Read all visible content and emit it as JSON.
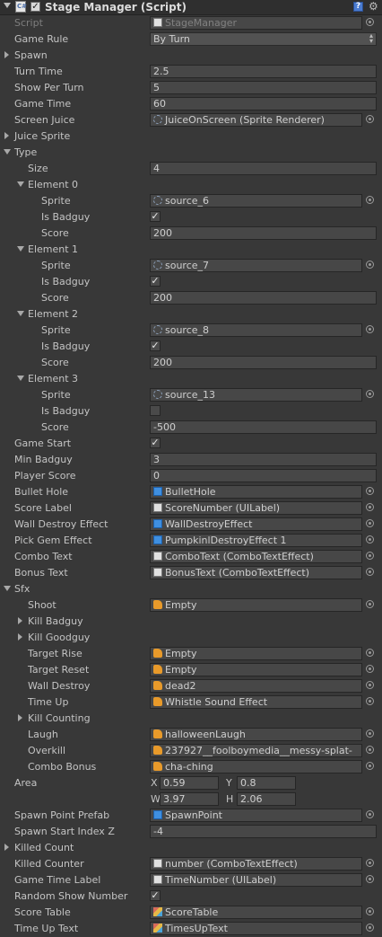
{
  "component": {
    "title": "Stage Manager (Script)",
    "enabled": true,
    "icons": [
      "script-icon",
      "help-icon",
      "gear-icon"
    ]
  },
  "fields": {
    "script": {
      "label": "Script",
      "value": "StageManager"
    },
    "game_rule": {
      "label": "Game Rule",
      "value": "By Turn"
    },
    "spawn": {
      "label": "Spawn"
    },
    "turn_time": {
      "label": "Turn Time",
      "value": "2.5"
    },
    "show_per_turn": {
      "label": "Show Per Turn",
      "value": "5"
    },
    "game_time": {
      "label": "Game Time",
      "value": "60"
    },
    "screen_juice": {
      "label": "Screen Juice",
      "value": "JuiceOnScreen (Sprite Renderer)"
    },
    "juice_sprite": {
      "label": "Juice Sprite"
    },
    "type": {
      "label": "Type"
    },
    "size": {
      "label": "Size",
      "value": "4"
    },
    "sprite_label": "Sprite",
    "is_badguy_label": "Is Badguy",
    "score_label": "Score",
    "elements": [
      {
        "label": "Element 0",
        "sprite": "source_6",
        "is_badguy": true,
        "score": "200"
      },
      {
        "label": "Element 1",
        "sprite": "source_7",
        "is_badguy": true,
        "score": "200"
      },
      {
        "label": "Element 2",
        "sprite": "source_8",
        "is_badguy": true,
        "score": "200"
      },
      {
        "label": "Element 3",
        "sprite": "source_13",
        "is_badguy": false,
        "score": "-500"
      }
    ],
    "game_start": {
      "label": "Game Start",
      "checked": true
    },
    "min_badguy": {
      "label": "Min Badguy",
      "value": "3"
    },
    "player_score": {
      "label": "Player Score",
      "value": "0"
    },
    "bullet_hole": {
      "label": "Bullet Hole",
      "value": "BulletHole"
    },
    "score_label_field": {
      "label": "Score Label",
      "value": "ScoreNumber (UILabel)"
    },
    "wall_destroy_effect": {
      "label": "Wall Destroy Effect",
      "value": "WallDestroyEffect"
    },
    "pick_gem_effect": {
      "label": "Pick Gem Effect",
      "value": "PumpkinlDestroyEffect 1"
    },
    "combo_text": {
      "label": "Combo Text",
      "value": "ComboText (ComboTextEffect)"
    },
    "bonus_text": {
      "label": "Bonus Text",
      "value": "BonusText (ComboTextEffect)"
    },
    "sfx": {
      "label": "Sfx"
    },
    "shoot": {
      "label": "Shoot",
      "value": "Empty"
    },
    "kill_badguy": {
      "label": "Kill Badguy"
    },
    "kill_goodguy": {
      "label": "Kill Goodguy"
    },
    "target_rise": {
      "label": "Target Rise",
      "value": "Empty"
    },
    "target_reset": {
      "label": "Target Reset",
      "value": "Empty"
    },
    "wall_destroy": {
      "label": "Wall Destroy",
      "value": "dead2"
    },
    "time_up": {
      "label": "Time Up",
      "value": "Whistle Sound Effect"
    },
    "kill_counting": {
      "label": "Kill Counting"
    },
    "laugh": {
      "label": "Laugh",
      "value": "halloweenLaugh"
    },
    "overkill": {
      "label": "Overkill",
      "value": "237927__foolboymedia__messy-splat-"
    },
    "combo_bonus": {
      "label": "Combo Bonus",
      "value": "cha-ching"
    },
    "area": {
      "label": "Area",
      "x_label": "X",
      "x": "0.59",
      "y_label": "Y",
      "y": "0.8",
      "w_label": "W",
      "w": "3.97",
      "h_label": "H",
      "h": "2.06"
    },
    "spawn_point_prefab": {
      "label": "Spawn Point Prefab",
      "value": "SpawnPoint"
    },
    "spawn_start_index_z": {
      "label": "Spawn Start Index Z",
      "value": "-4"
    },
    "killed_count": {
      "label": "Killed Count"
    },
    "killed_counter": {
      "label": "Killed Counter",
      "value": "number (ComboTextEffect)"
    },
    "game_time_label": {
      "label": "Game Time Label",
      "value": "TimeNumber (UILabel)"
    },
    "random_show_number": {
      "label": "Random Show Number",
      "checked": true
    },
    "score_table": {
      "label": "Score Table",
      "value": "ScoreTable"
    },
    "time_up_text": {
      "label": "Time Up Text",
      "value": "TimesUpText"
    }
  },
  "colors": {
    "background": "#383838",
    "field": "#474747",
    "header": "#2f2f2f"
  }
}
